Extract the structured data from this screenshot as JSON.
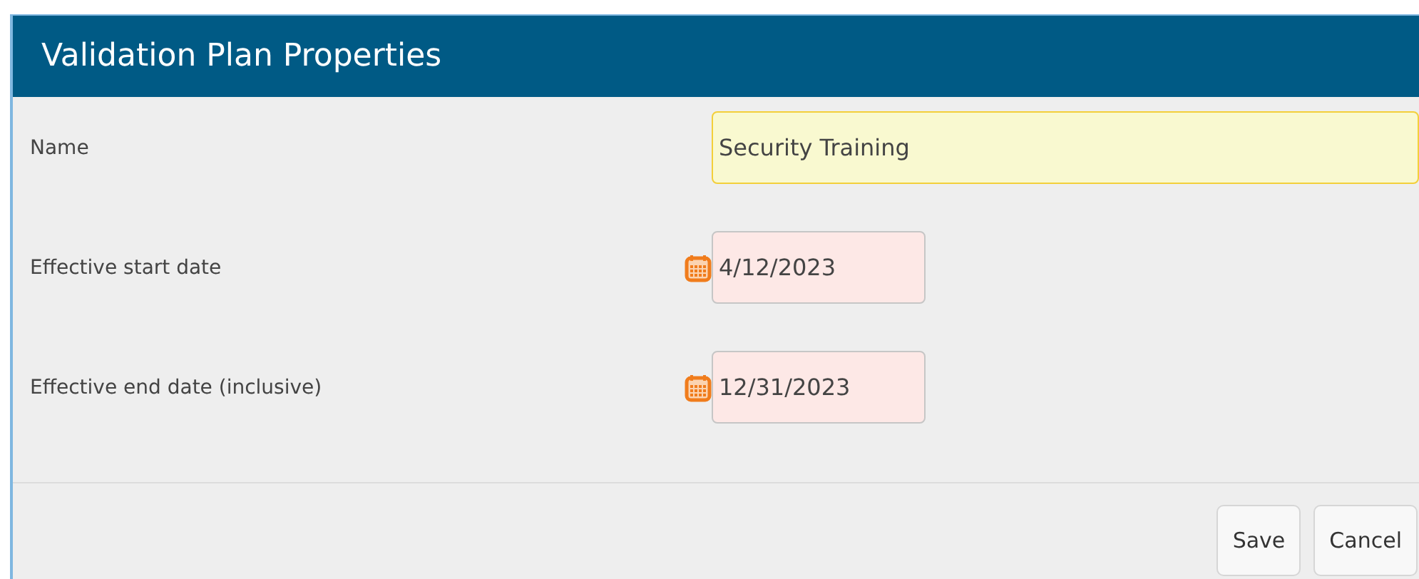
{
  "dialog": {
    "title": "Validation Plan Properties"
  },
  "fields": [
    {
      "label": "Name",
      "kind": "text",
      "value": "Security Training",
      "focused": true
    },
    {
      "label": "Effective start date",
      "kind": "date",
      "value": "4/12/2023",
      "focused": false
    },
    {
      "label": "Effective end date (inclusive)",
      "kind": "date",
      "value": "12/31/2023",
      "focused": false
    }
  ],
  "buttons": [
    "Save",
    "Cancel"
  ]
}
